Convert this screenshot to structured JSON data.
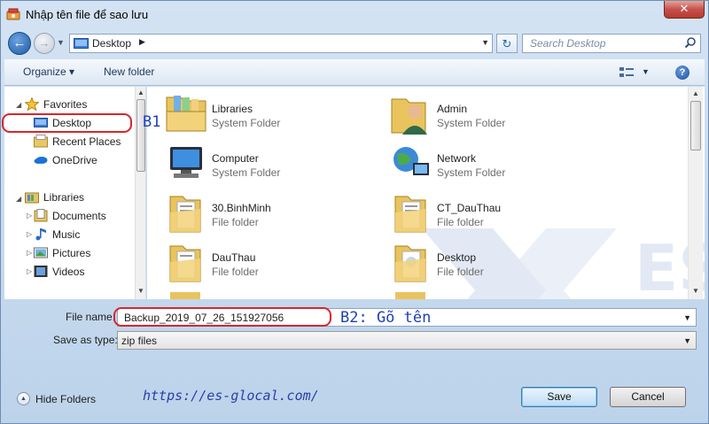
{
  "window": {
    "title": "Nhập tên file để sao lưu",
    "close_label": "✕"
  },
  "addressbar": {
    "location": "Desktop",
    "search_placeholder": "Search Desktop"
  },
  "toolbar": {
    "organize_label": "Organize ▾",
    "new_folder_label": "New folder",
    "help_label": "?"
  },
  "nav": {
    "favorites_label": "Favorites",
    "favorites_items": [
      "Desktop",
      "Recent Places",
      "OneDrive"
    ],
    "libraries_label": "Libraries",
    "libraries_items": [
      "Documents",
      "Music",
      "Pictures",
      "Videos"
    ]
  },
  "files": [
    {
      "name": "Libraries",
      "type": "System Folder",
      "icon": "libraries-icon"
    },
    {
      "name": "Admin",
      "type": "System Folder",
      "icon": "user-folder-icon"
    },
    {
      "name": "Computer",
      "type": "System Folder",
      "icon": "computer-icon"
    },
    {
      "name": "Network",
      "type": "System Folder",
      "icon": "network-icon"
    },
    {
      "name": "30.BinhMinh",
      "type": "File folder",
      "icon": "folder-icon"
    },
    {
      "name": "CT_DauThau",
      "type": "File folder",
      "icon": "folder-icon"
    },
    {
      "name": "DauThau",
      "type": "File folder",
      "icon": "folder-icon"
    },
    {
      "name": "Desktop",
      "type": "File folder",
      "icon": "folder-icon"
    }
  ],
  "form": {
    "filename_label": "File name:",
    "filename_value": "Backup_2019_07_26_151927056",
    "savetype_label": "Save as type:",
    "savetype_value": "zip files"
  },
  "footer": {
    "hide_folders_label": "Hide Folders",
    "save_label": "Save",
    "cancel_label": "Cancel"
  },
  "annotations": {
    "step1": "B1",
    "step2": "B2: Gõ tên",
    "url": "https://es-glocal.com/",
    "oval_color": "#d9262c",
    "text_color": "#1d3fb8"
  },
  "watermark_text": "ES GLOCAL"
}
